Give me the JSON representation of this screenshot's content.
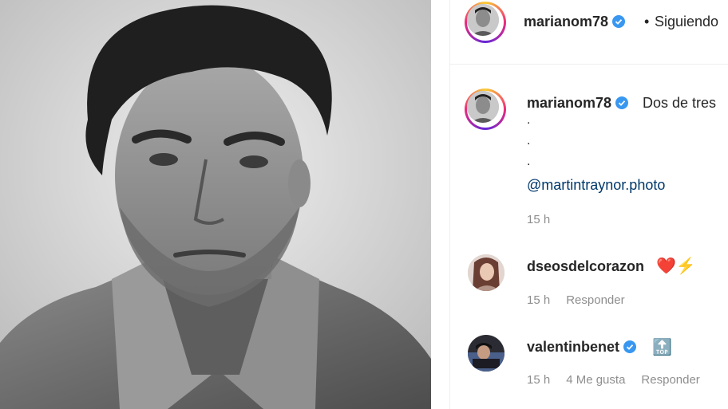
{
  "post": {
    "author": "marianom78",
    "follow_separator": "•",
    "follow_status": "Siguiendo"
  },
  "caption": {
    "author": "marianom78",
    "text": "Dos de tres",
    "dots": [
      ".",
      ".",
      "."
    ],
    "mention": "@martintraynor.photo",
    "time": "15 h"
  },
  "comments": [
    {
      "author": "dseosdelcorazon",
      "emoji": "❤️⚡",
      "time": "15 h",
      "reply": "Responder"
    },
    {
      "author": "valentinbenet",
      "emoji": "🔝",
      "time": "15 h",
      "likes": "4 Me gusta",
      "reply": "Responder"
    }
  ],
  "colors": {
    "verified": "#3897f0",
    "link": "#00376b",
    "meta": "#8e8e8e"
  }
}
